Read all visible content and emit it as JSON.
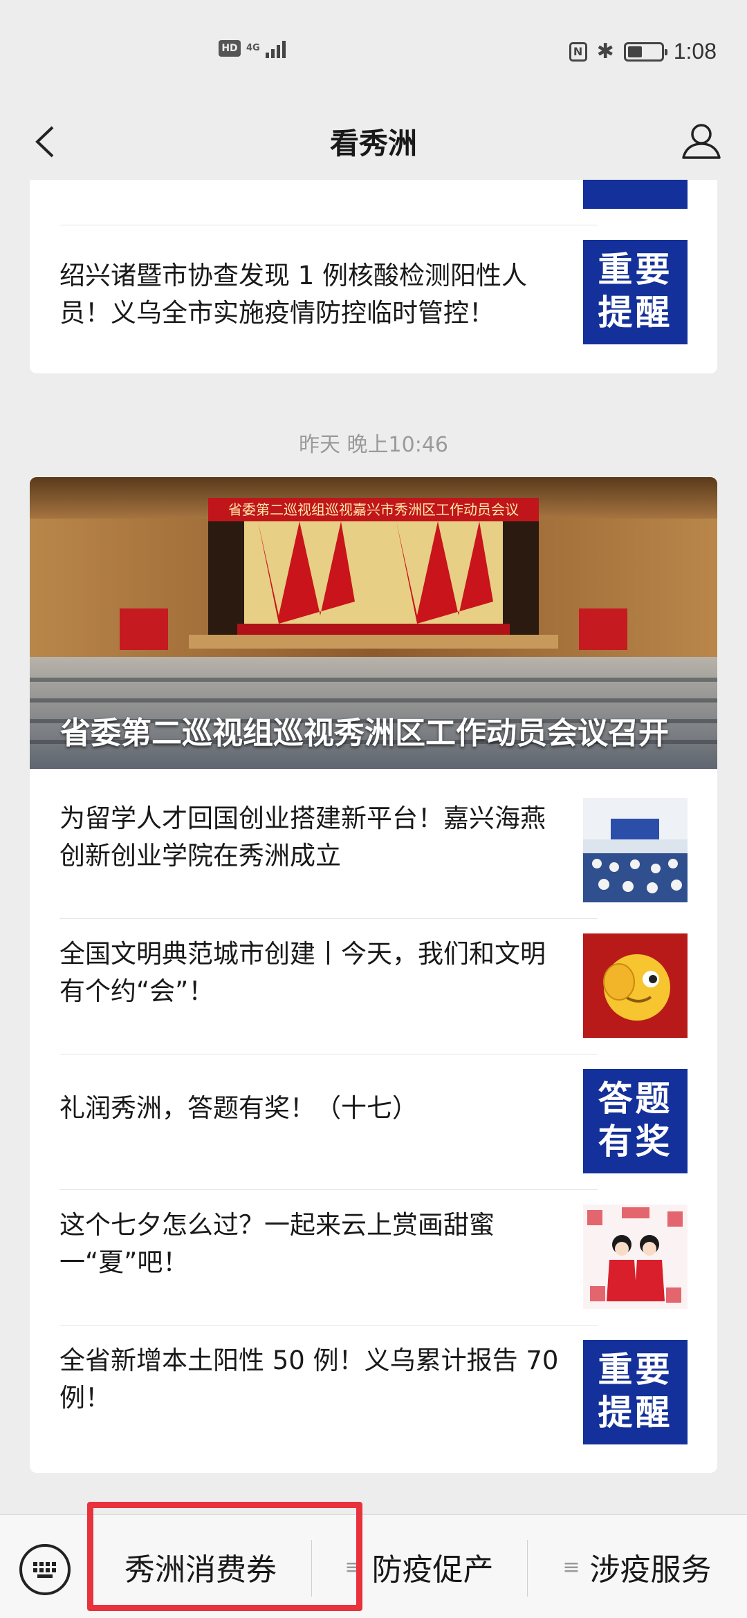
{
  "status_bar": {
    "hd_label": "HD",
    "network": "4G",
    "nfc_label": "N",
    "time": "1:08"
  },
  "nav": {
    "title": "看秀洲"
  },
  "card1": {
    "title": "绍兴诸暨市协查发现 1 例核酸检测阳性人员！义乌全市实施疫情防控临时管控！",
    "thumb_text": "重要提醒"
  },
  "timestamp": "昨天 晚上10:46",
  "card2": {
    "hero": {
      "banner": "省委第二巡视组巡视嘉兴市秀洲区工作动员会议",
      "title": "省委第二巡视组巡视秀洲区工作动员会议召开"
    },
    "items": [
      {
        "title": "为留学人才回国创业搭建新平台！嘉兴海燕创新创业学院在秀洲成立",
        "thumb": "photo"
      },
      {
        "title": "全国文明典范城市创建丨今天，我们和文明有个约“会”！",
        "thumb": "emoji"
      },
      {
        "title": "礼润秀洲，答题有奖！（十七）",
        "thumb": "答题有奖"
      },
      {
        "title": "这个七夕怎么过？一起来云上赏画甜蜜一“夏”吧！",
        "thumb": "illustration"
      },
      {
        "title": "全省新增本土阳性 50 例！义乌累计报告 70 例！",
        "thumb": "重要提醒"
      }
    ]
  },
  "bottom_menu": {
    "items": [
      "秀洲消费券",
      "防疫促产",
      "涉疫服务"
    ],
    "glyph": "≡"
  },
  "colors": {
    "background": "#ededed",
    "thumb_blue": "#14309a",
    "highlight": "#e8323c"
  }
}
